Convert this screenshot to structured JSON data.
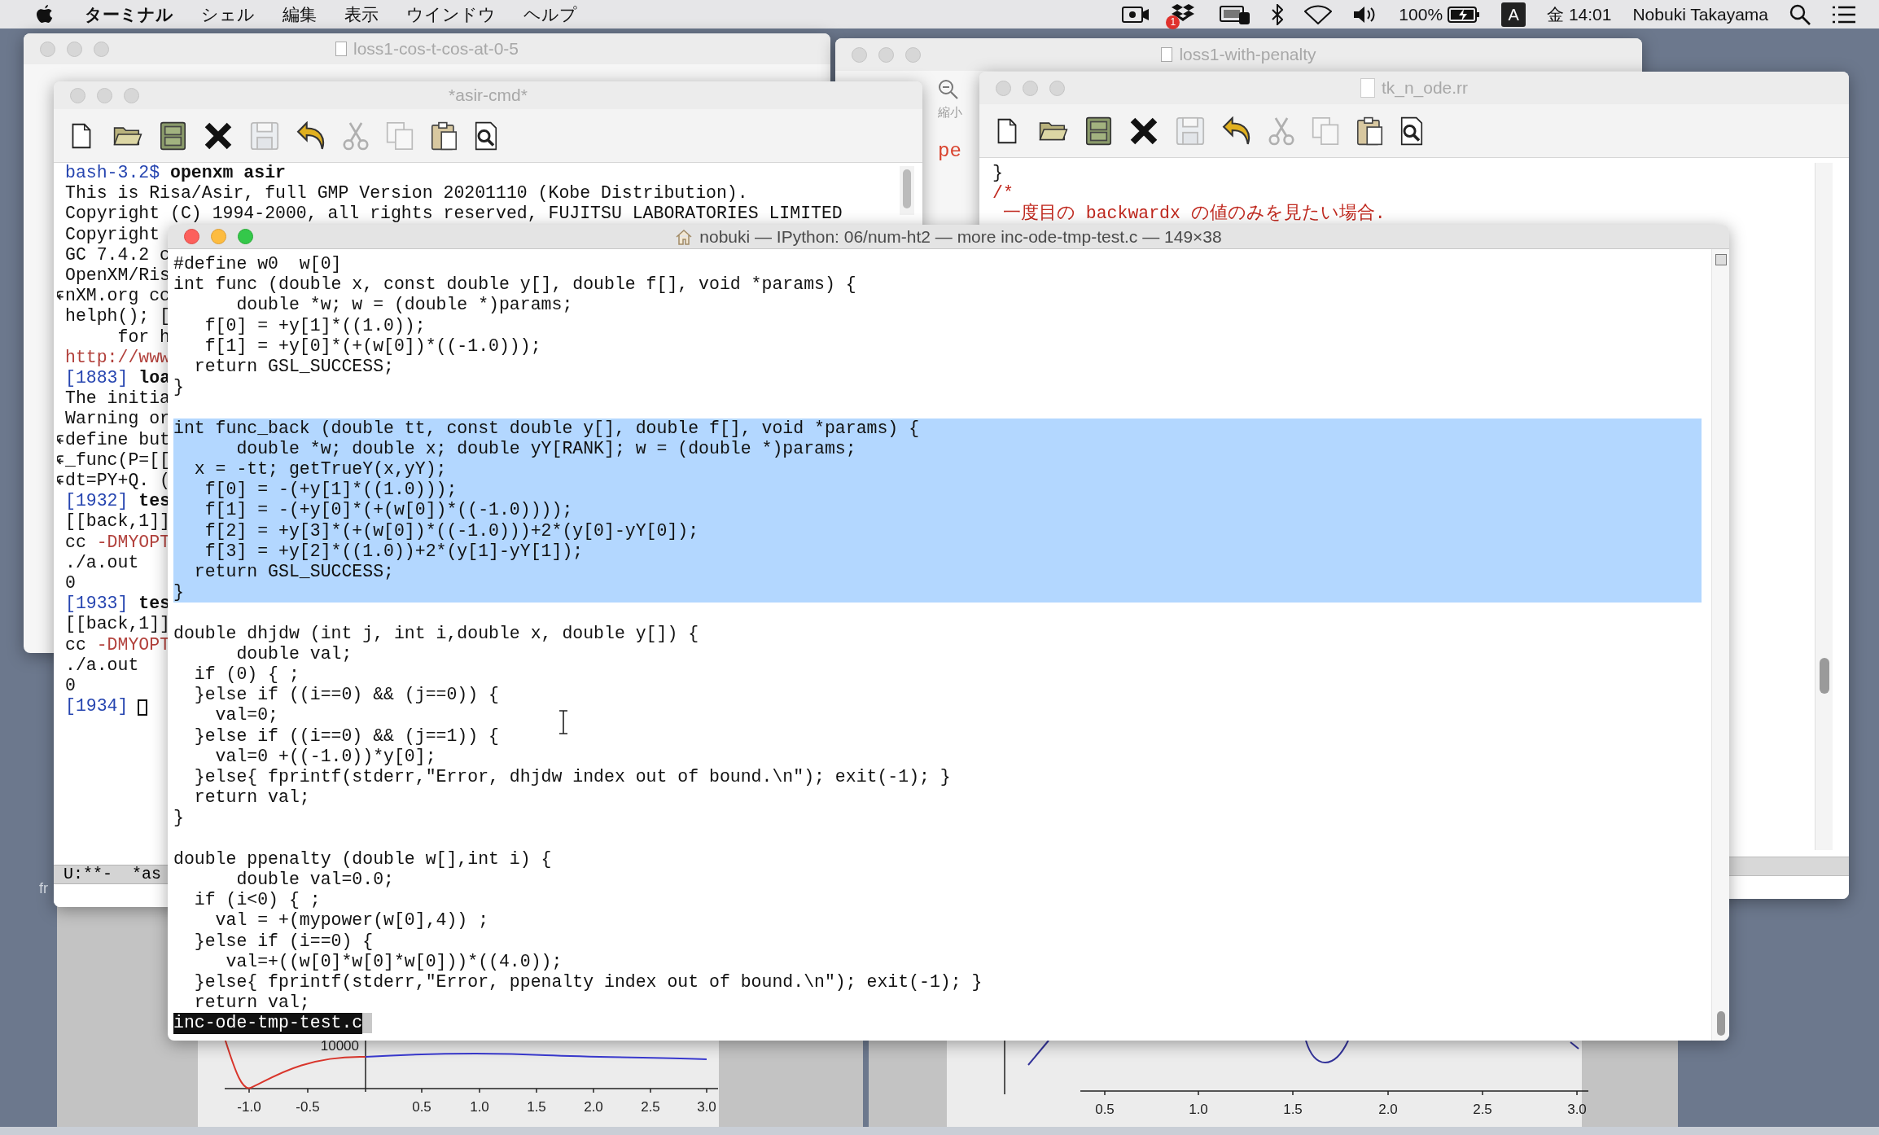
{
  "menu_bar": {
    "app_menu": "ターミナル",
    "menus": [
      "シェル",
      "編集",
      "表示",
      "ウインドウ",
      "ヘルプ"
    ],
    "dropbox_badge": "1",
    "battery": "100%",
    "input_source": "A",
    "clock": "金 14:01",
    "user": "Nobuki Takayama"
  },
  "windows": {
    "editor_back_left": {
      "title": "loss1-cos-t-cos-at-0-5"
    },
    "editor_back_right": {
      "title": "loss1-with-penalty",
      "toolbar_label": "縮小",
      "text_fragment": "pe"
    },
    "emacs_right": {
      "title": "tk_n_ode.rr",
      "toolbar": [
        {
          "kind": "new",
          "disabled": false
        },
        {
          "kind": "open",
          "disabled": false
        },
        {
          "kind": "cabinet",
          "disabled": false
        },
        {
          "kind": "close",
          "disabled": false
        },
        {
          "kind": "save",
          "disabled": true
        },
        {
          "kind": "undo",
          "disabled": false
        },
        {
          "kind": "cut",
          "disabled": true
        },
        {
          "kind": "copy",
          "disabled": true
        },
        {
          "kind": "paste",
          "disabled": false
        },
        {
          "kind": "find",
          "disabled": false
        }
      ],
      "lines": [
        {
          "text": "}",
          "kind": "code"
        },
        {
          "text": "/*",
          "kind": "comment"
        },
        {
          "text": " 一度目の backwardx の値のみを見たい場合.",
          "kind": "comment"
        }
      ]
    },
    "emacs_left": {
      "title": "*asir-cmd*",
      "toolbar": [
        {
          "kind": "new",
          "disabled": false
        },
        {
          "kind": "open",
          "disabled": false
        },
        {
          "kind": "cabinet",
          "disabled": false
        },
        {
          "kind": "close",
          "disabled": false
        },
        {
          "kind": "save",
          "disabled": true
        },
        {
          "kind": "undo",
          "disabled": false
        },
        {
          "kind": "cut",
          "disabled": true
        },
        {
          "kind": "copy",
          "disabled": true
        },
        {
          "kind": "paste",
          "disabled": false
        },
        {
          "kind": "find",
          "disabled": false
        }
      ],
      "lines": [
        {
          "wrapped": false,
          "parts": [
            {
              "text": "bash-3.2$ ",
              "kind": "prompt"
            },
            {
              "text": "openxm asir",
              "kind": "command"
            }
          ]
        },
        {
          "wrapped": false,
          "parts": [
            {
              "text": "This is Risa/Asir, full GMP Version 20201110 (Kobe Distribution).",
              "kind": "plain"
            }
          ]
        },
        {
          "wrapped": false,
          "parts": [
            {
              "text": "Copyright (C) 1994-2000, all rights reserved, FUJITSU LABORATORIES LIMITED",
              "kind": "plain"
            }
          ]
        },
        {
          "wrapped": false,
          "parts": [
            {
              "text": "Copyright",
              "kind": "plain"
            }
          ]
        },
        {
          "wrapped": false,
          "parts": [
            {
              "text": "GC 7.4.2 c",
              "kind": "plain"
            }
          ]
        },
        {
          "wrapped": false,
          "parts": [
            {
              "text": "OpenXM/Ris",
              "kind": "plain"
            }
          ]
        },
        {
          "wrapped": true,
          "parts": [
            {
              "text": "nXM.org cc",
              "kind": "plain"
            }
          ]
        },
        {
          "wrapped": false,
          "parts": [
            {
              "text": "helph(); [",
              "kind": "plain"
            }
          ]
        },
        {
          "wrapped": false,
          "parts": [
            {
              "text": "     for h",
              "kind": "plain"
            }
          ]
        },
        {
          "wrapped": false,
          "parts": [
            {
              "text": "http://www",
              "kind": "link"
            }
          ]
        },
        {
          "wrapped": false,
          "parts": [
            {
              "text": "[1883] ",
              "kind": "prompt"
            },
            {
              "text": "loa",
              "kind": "command"
            }
          ]
        },
        {
          "wrapped": false,
          "parts": [
            {
              "text": "The initia",
              "kind": "plain"
            }
          ]
        },
        {
          "wrapped": false,
          "parts": [
            {
              "text": "Warning or",
              "kind": "plain"
            }
          ]
        },
        {
          "wrapped": true,
          "parts": [
            {
              "text": "define but",
              "kind": "plain"
            }
          ]
        },
        {
          "wrapped": true,
          "parts": [
            {
              "text": "_func(P=[[",
              "kind": "plain"
            }
          ]
        },
        {
          "wrapped": true,
          "parts": [
            {
              "text": "dt=PY+Q. (",
              "kind": "plain"
            }
          ]
        },
        {
          "wrapped": false,
          "parts": [
            {
              "text": "[1932] ",
              "kind": "prompt"
            },
            {
              "text": "tes",
              "kind": "command"
            }
          ]
        },
        {
          "wrapped": false,
          "parts": [
            {
              "text": "[[back,1]]",
              "kind": "plain"
            }
          ]
        },
        {
          "wrapped": false,
          "parts": [
            {
              "text": "cc ",
              "kind": "plain"
            },
            {
              "text": "-DMYOPT",
              "kind": "option"
            }
          ]
        },
        {
          "wrapped": false,
          "parts": [
            {
              "text": "./a.out",
              "kind": "plain"
            }
          ]
        },
        {
          "wrapped": false,
          "parts": [
            {
              "text": "0",
              "kind": "plain"
            }
          ]
        },
        {
          "wrapped": false,
          "parts": [
            {
              "text": "[1933] ",
              "kind": "prompt"
            },
            {
              "text": "tes",
              "kind": "command"
            }
          ]
        },
        {
          "wrapped": false,
          "parts": [
            {
              "text": "[[back,1]]",
              "kind": "plain"
            }
          ]
        },
        {
          "wrapped": false,
          "parts": [
            {
              "text": "cc ",
              "kind": "plain"
            },
            {
              "text": "-DMYOPT",
              "kind": "option"
            }
          ]
        },
        {
          "wrapped": false,
          "parts": [
            {
              "text": "./a.out",
              "kind": "plain"
            }
          ]
        },
        {
          "wrapped": false,
          "parts": [
            {
              "text": "0",
              "kind": "plain"
            }
          ]
        },
        {
          "wrapped": false,
          "parts": [
            {
              "text": "[1934]",
              "kind": "prompt"
            }
          ]
        }
      ],
      "mode_line": "U:**-  *as"
    },
    "terminal": {
      "title": "nobuki — IPython: 06/num-ht2 — more inc-ode-tmp-test.c — 149×38",
      "blocks": [
        {
          "selected": false,
          "lines": [
            "#define w0  w[0]",
            "int func (double x, const double y[], double f[], void *params) {",
            "      double *w; w = (double *)params;",
            "   f[0] = +y[1]*((1.0));",
            "   f[1] = +y[0]*(+(w[0])*((-1.0)));",
            "  return GSL_SUCCESS;",
            "}"
          ]
        },
        {
          "selected": true,
          "lines": [
            "int func_back (double tt, const double y[], double f[], void *params) {",
            "      double *w; double x; double yY[RANK]; w = (double *)params;",
            "  x = -tt; getTrueY(x,yY);",
            "   f[0] = -(+y[1]*((1.0)));",
            "   f[1] = -(+y[0]*(+(w[0])*((-1.0))));",
            "   f[2] = +y[3]*(+(w[0])*((-1.0)))+2*(y[0]-yY[0]);",
            "   f[3] = +y[2]*((1.0))+2*(y[1]-yY[1]);",
            "  return GSL_SUCCESS;",
            "}"
          ]
        },
        {
          "selected": false,
          "lines": [
            "double dhjdw (int j, int i,double x, double y[]) {",
            "      double val;",
            "  if (0) { ;",
            "  }else if ((i==0) && (j==0)) {",
            "    val=0;",
            "  }else if ((i==0) && (j==1)) {",
            "    val=0 +((-1.0))*y[0];",
            "  }else{ fprintf(stderr,\"Error, dhjdw index out of bound.\\n\"); exit(-1); }",
            "  return val;",
            "}"
          ]
        },
        {
          "selected": false,
          "lines": [
            "double ppenalty (double w[],int i) {",
            "      double val=0.0;",
            "  if (i<0) { ;",
            "    val = +(mypower(w[0],4)) ;",
            "  }else if (i==0) {",
            "     val=+((w[0]*w[0]*w[0]))*((4.0));",
            "  }else{ fprintf(stderr,\"Error, ppenalty index out of bound.\\n\"); exit(-1); }",
            "  return val;"
          ]
        }
      ],
      "status": "inc-ode-tmp-test.c"
    },
    "plot_left": {
      "y_tick": "10000",
      "x_ticks": [
        "-1.0",
        "-0.5",
        "0.5",
        "1.0",
        "1.5",
        "2.0",
        "2.5",
        "3.0"
      ]
    },
    "plot_right": {
      "x_ticks": [
        "0.5",
        "1.0",
        "1.5",
        "2.0",
        "2.5",
        "3.0"
      ]
    }
  },
  "desktop_text": "fr"
}
